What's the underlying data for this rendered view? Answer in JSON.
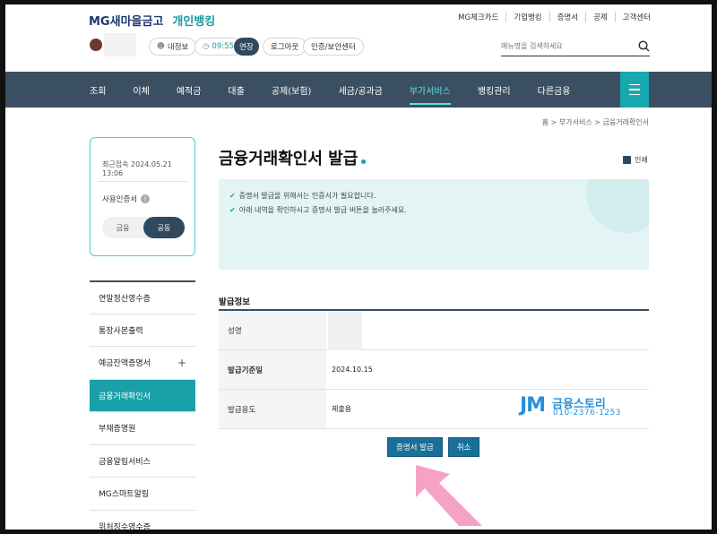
{
  "header": {
    "logo_mg": "MG새마을금고",
    "logo_sub": "개인뱅킹",
    "util_links": [
      "MG체크카드",
      "기업뱅킹",
      "증명서",
      "공제",
      "고객센터"
    ],
    "info_label": "내정보",
    "timer": "09:55",
    "extend_label": "연장",
    "logout_label": "로그아웃",
    "auth_label": "인증/보안센터",
    "search_placeholder": "메뉴명을 검색하세요"
  },
  "nav": {
    "items": [
      "조회",
      "이체",
      "예적금",
      "대출",
      "공제(보험)",
      "세금/공과금",
      "부가서비스",
      "뱅킹관리",
      "다른금융"
    ],
    "active_index": 6
  },
  "breadcrumb": "홈 > 부가서비스 > 금융거래확인서",
  "login_card": {
    "recent_login": "최근접속 2024.05.21 13:06",
    "cert_label": "사용인증서",
    "seg_left": "금융",
    "seg_right": "공동"
  },
  "side_menu": [
    {
      "label": "연말정산영수증"
    },
    {
      "label": "통장사본출력"
    },
    {
      "label": "예금잔액증명서",
      "expand": "+"
    },
    {
      "label": "금융거래확인서"
    },
    {
      "label": "부채증명원"
    },
    {
      "label": "금융알림서비스"
    },
    {
      "label": "MG스마트알림"
    },
    {
      "label": "위처징수영수증"
    }
  ],
  "page": {
    "title": "금융거래확인서 발급",
    "print_label": "인쇄",
    "notices": [
      "증명서 발급을 위해서는 인증서가 필요합니다.",
      "아래 내역을 확인하시고 증명서 발급 버튼을 눌러주세요."
    ],
    "section_title": "발급정보",
    "rows": [
      {
        "label": "성명",
        "value": ""
      },
      {
        "label": "발급기준일",
        "value": "2024.10.15"
      },
      {
        "label": "발급용도",
        "value": "제출용"
      }
    ],
    "issue_button": "증명서 발급",
    "cancel_button": "취소"
  },
  "watermark": {
    "jm": "JM",
    "brand": "금융스토리",
    "tel": "010-2376-1253"
  },
  "colors": {
    "nav_bg": "#3a4f61",
    "accent": "#1aa0a8",
    "button": "#1a6f98",
    "arrow": "#f59ac0"
  }
}
